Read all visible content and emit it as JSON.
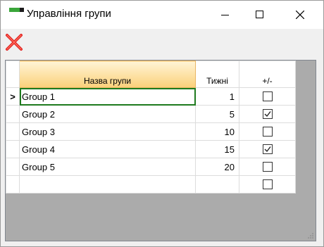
{
  "window": {
    "title": "Управління групи"
  },
  "toolbar": {
    "delete_icon": "red-x-icon",
    "delete_color": "#e02020"
  },
  "grid": {
    "columns": [
      {
        "label": "Назва групи"
      },
      {
        "label": "Тижні"
      },
      {
        "label": "+/-"
      }
    ],
    "current_row_marker": ">",
    "rows": [
      {
        "name": "Group 1",
        "weeks": "1",
        "checked": false
      },
      {
        "name": "Group 2",
        "weeks": "5",
        "checked": true
      },
      {
        "name": "Group 3",
        "weeks": "10",
        "checked": false
      },
      {
        "name": "Group 4",
        "weeks": "15",
        "checked": true
      },
      {
        "name": "Group 5",
        "weeks": "20",
        "checked": false
      },
      {
        "name": "",
        "weeks": "",
        "checked": false
      }
    ]
  },
  "colors": {
    "accent_green": "#1e7a1e",
    "header_orange": "#fbd07a"
  }
}
